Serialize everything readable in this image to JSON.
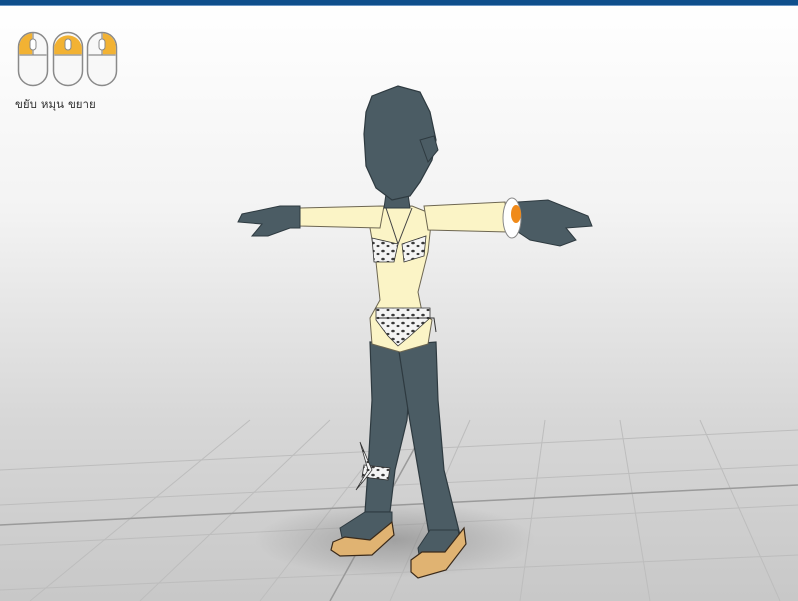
{
  "window": {
    "title": ""
  },
  "mouse_controls": [
    {
      "label": "ขยับ",
      "icon": "mouse-left-button-icon",
      "highlight": "left"
    },
    {
      "label": "หมุน",
      "icon": "mouse-middle-button-icon",
      "highlight": "middle"
    },
    {
      "label": "ขยาย",
      "icon": "mouse-right-button-icon",
      "highlight": "right"
    }
  ],
  "colors": {
    "title_bar": "#0f4f8c",
    "mouse_highlight": "#f2b233",
    "character_dark": "#4b5c64",
    "skin": "#fbf4c6",
    "sole": "#e0b372",
    "accent_orange": "#f08a1a"
  }
}
